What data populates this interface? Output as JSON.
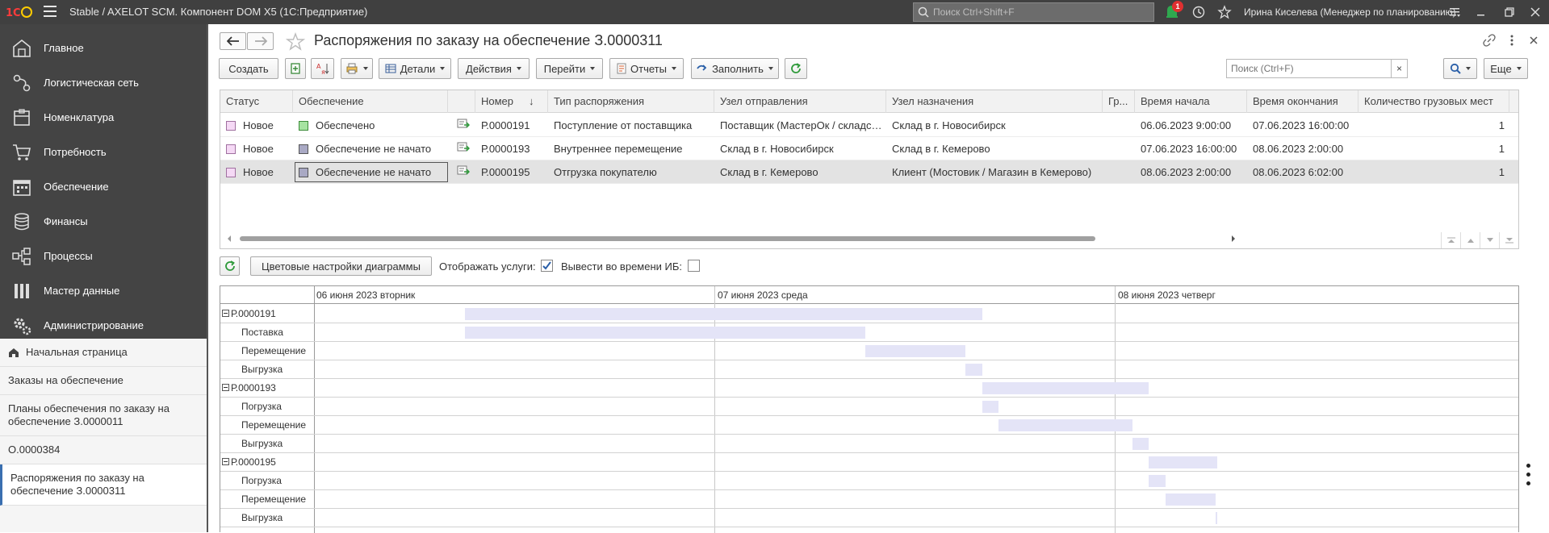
{
  "topbar": {
    "title": "Stable / AXELOT SCM. Компонент DOM X5  (1С:Предприятие)",
    "search_placeholder": "Поиск Ctrl+Shift+F",
    "notifications_count": "1",
    "user": "Ирина Киселева (Менеджер по планированию)"
  },
  "sidebar": {
    "nav": [
      {
        "label": "Главное",
        "icon": "home-grid-icon"
      },
      {
        "label": "Логистическая сеть",
        "icon": "truck-icon"
      },
      {
        "label": "Номенклатура",
        "icon": "box-icon"
      },
      {
        "label": "Потребность",
        "icon": "cart-icon"
      },
      {
        "label": "Обеспечение",
        "icon": "calendar-icon"
      },
      {
        "label": "Финансы",
        "icon": "coins-icon"
      },
      {
        "label": "Процессы",
        "icon": "flow-icon"
      },
      {
        "label": "Мастер данные",
        "icon": "bars-icon"
      },
      {
        "label": "Администрирование",
        "icon": "gears-icon"
      }
    ],
    "open": {
      "home": "Начальная страница",
      "items": [
        "Заказы на обеспечение",
        "Планы обеспечения по заказу на обеспечение З.0000011",
        "О.0000384",
        "Распоряжения по заказу на обеспечение З.0000311"
      ]
    }
  },
  "form": {
    "title": "Распоряжения по заказу на обеспечение З.0000311",
    "toolbar": {
      "create": "Создать",
      "details": "Детали",
      "actions": "Действия",
      "goto": "Перейти",
      "reports": "Отчеты",
      "fill": "Заполнить",
      "more": "Еще"
    },
    "search_placeholder": "Поиск (Ctrl+F)",
    "search_clear": "×"
  },
  "table": {
    "columns": [
      "Статус",
      "Обеспечение",
      "Номер",
      "Тип распоряжения",
      "Узел отправления",
      "Узел назначения",
      "Гр...",
      "Время начала",
      "Время окончания",
      "Количество грузовых мест"
    ],
    "sort_indicator": "↓",
    "rows": [
      {
        "status": "Новое",
        "provision": "Обеспечено",
        "provision_color": "#a6e3a1",
        "number": "Р.0000191",
        "type": "Поступление от поставщика",
        "from": "Поставщик (МастерОк / складской комплекс)",
        "to": "Склад в г. Новосибирск",
        "gr": "",
        "start": "06.06.2023 9:00:00",
        "end": "07.06.2023 16:00:00",
        "qty": "1"
      },
      {
        "status": "Новое",
        "provision": "Обеспечение не начато",
        "provision_color": "#a9a9c4",
        "number": "Р.0000193",
        "type": "Внутреннее перемещение",
        "from": "Склад в г. Новосибирск",
        "to": "Склад в г. Кемерово",
        "gr": "",
        "start": "07.06.2023 16:00:00",
        "end": "08.06.2023 2:00:00",
        "qty": "1"
      },
      {
        "status": "Новое",
        "provision": "Обеспечение не начато",
        "provision_color": "#a9a9c4",
        "number": "Р.0000195",
        "type": "Отгрузка покупателю",
        "from": "Склад в г. Кемерово",
        "to": "Клиент (Мостовик / Магазин в Кемерово)",
        "gr": "",
        "start": "08.06.2023 2:00:00",
        "end": "08.06.2023 6:02:00",
        "qty": "1"
      }
    ]
  },
  "gantt_controls": {
    "color_settings": "Цветовые настройки диаграммы",
    "show_services": "Отображать услуги:",
    "show_services_checked": true,
    "ib_time": "Вывести во времени ИБ:",
    "ib_time_checked": false
  },
  "gantt": {
    "dates": [
      "06 июня 2023 вторник",
      "07 июня 2023 среда",
      "08 июня 2023 четверг"
    ],
    "bar_color": "#e4e4f7",
    "rows": [
      {
        "label": "Р.0000191",
        "group": true,
        "start_h": 9.0,
        "end_h": 40.0
      },
      {
        "label": "Поставка",
        "group": false,
        "start_h": 9.0,
        "end_h": 33.0
      },
      {
        "label": "Перемещение",
        "group": false,
        "start_h": 33.0,
        "end_h": 39.0
      },
      {
        "label": "Выгрузка",
        "group": false,
        "start_h": 39.0,
        "end_h": 40.0
      },
      {
        "label": "Р.0000193",
        "group": true,
        "start_h": 40.0,
        "end_h": 50.0
      },
      {
        "label": "Погрузка",
        "group": false,
        "start_h": 40.0,
        "end_h": 41.0
      },
      {
        "label": "Перемещение",
        "group": false,
        "start_h": 41.0,
        "end_h": 49.0
      },
      {
        "label": "Выгрузка",
        "group": false,
        "start_h": 49.0,
        "end_h": 50.0
      },
      {
        "label": "Р.0000195",
        "group": true,
        "start_h": 50.0,
        "end_h": 54.1
      },
      {
        "label": "Погрузка",
        "group": false,
        "start_h": 50.0,
        "end_h": 51.0
      },
      {
        "label": "Перемещение",
        "group": false,
        "start_h": 51.0,
        "end_h": 54.0
      },
      {
        "label": "Выгрузка",
        "group": false,
        "start_h": 54.0,
        "end_h": 54.1
      }
    ]
  }
}
